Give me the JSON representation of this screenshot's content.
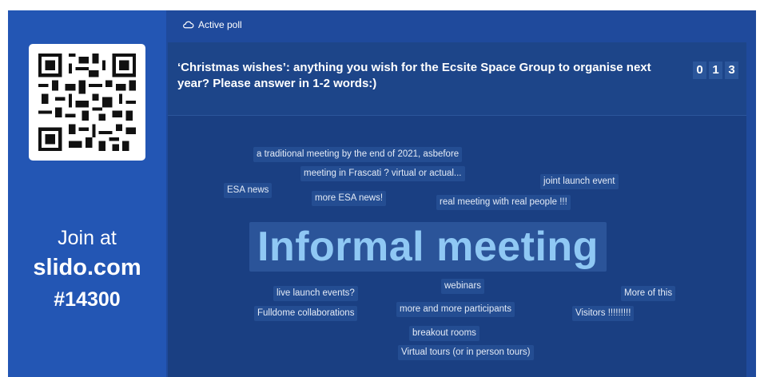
{
  "header": {
    "active_poll_label": "Active poll",
    "active_poll_icon": "cloud-icon"
  },
  "join": {
    "label": "Join at",
    "site": "slido.com",
    "code": "#14300"
  },
  "poll": {
    "question": "‘Christmas wishes’: anything you wish for the Ecsite Space Group to organise next year? Please answer in 1-2 words:)",
    "counter_digits": [
      "0",
      "1",
      "3"
    ]
  },
  "word_cloud": {
    "words": [
      "a traditional meeting by the end of 2021, asbefore",
      "meeting in Frascati ? virtual or actual...",
      "joint launch event",
      "ESA news",
      "more ESA news!",
      "real meeting with real people !!!",
      "Informal meeting",
      "live launch events?",
      "webinars",
      "More of this",
      "Fulldome collaborations",
      "more and more participants",
      "Visitors !!!!!!!!!",
      "breakout rooms",
      "Virtual tours (or in person tours)"
    ]
  },
  "colors": {
    "background_frame": "#1f4a9c",
    "left_panel": "#2356b4",
    "poll_card": "#1a3f82",
    "highlight_word": "#8fc8f4"
  }
}
